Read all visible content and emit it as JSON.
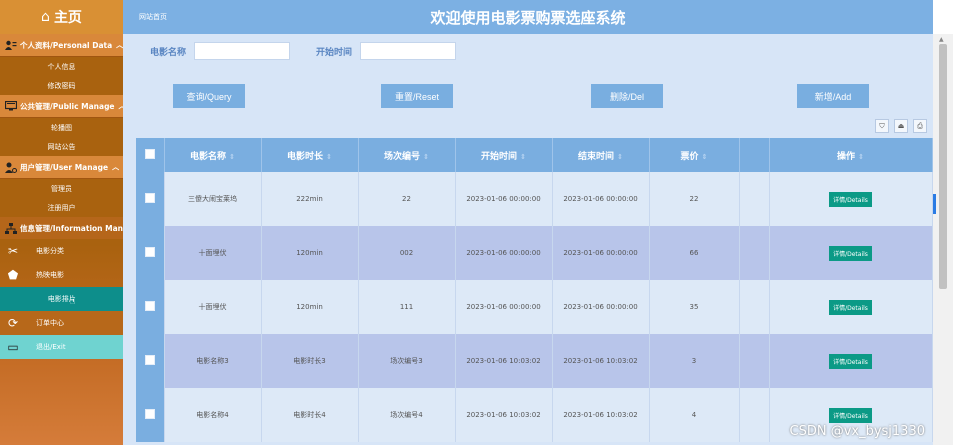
{
  "sidebar": {
    "brand": "主页",
    "groups": {
      "personal": {
        "label": "个人资料/Personal Data",
        "items": [
          "个人信息",
          "修改密码"
        ]
      },
      "public": {
        "label": "公共管理/Public Manage",
        "items": [
          "轮播图",
          "网站公告"
        ]
      },
      "user": {
        "label": "用户管理/User Manage",
        "items": [
          "管理员",
          "注册用户"
        ]
      },
      "info": {
        "label": "信息管理/Information Manage"
      }
    },
    "items": [
      "电影分类",
      "热映电影",
      "电影排片",
      "订单中心",
      "退出/Exit"
    ]
  },
  "header": {
    "crumb": "网站首页",
    "title": "欢迎使用电影票购票选座系统"
  },
  "search": {
    "movie_name_label": "电影名称",
    "movie_name_value": "",
    "start_time_label": "开始时间",
    "start_time_value": ""
  },
  "buttons": {
    "query": "查询/Query",
    "reset": "重置/Reset",
    "delete": "删除/Del",
    "add": "新增/Add"
  },
  "table": {
    "headers": [
      "电影名称",
      "电影时长",
      "场次编号",
      "开始时间",
      "结束时间",
      "票价",
      "",
      "操作"
    ],
    "detail_label": "详情/Details",
    "rows": [
      [
        "三傻大闹宝莱坞",
        "222min",
        "22",
        "2023-01-06 00:00:00",
        "2023-01-06 00:00:00",
        "22"
      ],
      [
        "十面埋伏",
        "120min",
        "002",
        "2023-01-06 00:00:00",
        "2023-01-06 00:00:00",
        "66"
      ],
      [
        "十面埋伏",
        "120min",
        "111",
        "2023-01-06 00:00:00",
        "2023-01-06 00:00:00",
        "35"
      ],
      [
        "电影名称3",
        "电影时长3",
        "场次编号3",
        "2023-01-06 10:03:02",
        "2023-01-06 10:03:02",
        "3"
      ],
      [
        "电影名称4",
        "电影时长4",
        "场次编号4",
        "2023-01-06 10:03:02",
        "2023-01-06 10:03:02",
        "4"
      ]
    ]
  },
  "watermark": "CSDN @vx_bysj1330",
  "colors": {
    "header": "#7cb0e3",
    "sidebar": "#b96a14",
    "active": "#0d8e8b",
    "detail": "#0b9a86"
  }
}
